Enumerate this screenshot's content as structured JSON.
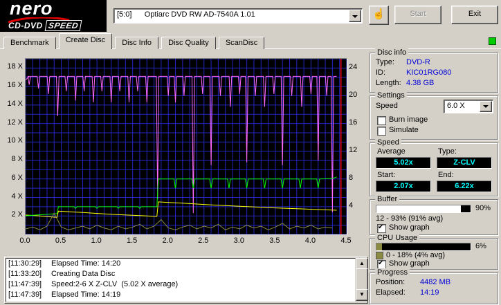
{
  "header": {
    "brand": "nero",
    "brand_sub1": "CD-DVD",
    "brand_sub2": "SPEED",
    "drive_select_value": "[5:0]      Optiarc DVD RW AD-7540A 1.01",
    "start_label": "Start",
    "exit_label": "Exit"
  },
  "tabs": [
    {
      "label": "Benchmark",
      "active": false
    },
    {
      "label": "Create Disc",
      "active": true
    },
    {
      "label": "Disc Info",
      "active": false
    },
    {
      "label": "Disc Quality",
      "active": false
    },
    {
      "label": "ScanDisc",
      "active": false
    }
  ],
  "disc_info": {
    "title": "Disc info",
    "rows": [
      {
        "label": "Type:",
        "value": "DVD-R"
      },
      {
        "label": "ID:",
        "value": "KIC01RG080"
      },
      {
        "label": "Length:",
        "value": "4.38 GB"
      }
    ]
  },
  "settings": {
    "title": "Settings",
    "speed_label": "Speed",
    "speed_value": "6.0 X",
    "checkboxes": [
      {
        "label": "Burn image",
        "checked": false
      },
      {
        "label": "Simulate",
        "checked": false
      }
    ]
  },
  "speed_panel": {
    "title": "Speed",
    "average_label": "Average",
    "type_label": "Type:",
    "average_value": "5.02x",
    "type_value": "Z-CLV",
    "start_label": "Start:",
    "end_label": "End:",
    "start_value": "2.07x",
    "end_value": "6.22x"
  },
  "buffer_panel": {
    "title": "Buffer",
    "fill_percent": 90,
    "bar_color": "#ffffff",
    "percent_label": "90%",
    "range_text": "12 - 93% (91% avg)",
    "show_graph_label": "Show graph",
    "show_graph_checked": true
  },
  "cpu_panel": {
    "title": "CPU Usage",
    "fill_percent": 6,
    "bar_color": "#8a8a42",
    "percent_label": "6%",
    "range_text": "0 - 18% (4% avg)",
    "show_graph_label": "Show graph",
    "show_graph_checked": true,
    "legend_color": "#8a8a42"
  },
  "progress_panel": {
    "title": "Progress",
    "position_label": "Position:",
    "position_value": "4482 MB",
    "elapsed_label": "Elapsed:",
    "elapsed_value": "14:19"
  },
  "log": {
    "lines": [
      {
        "time": "[11:30:29]",
        "text": "Elapsed Time: 14:20"
      },
      {
        "time": "[11:33:20]",
        "text": "Creating Data Disc"
      },
      {
        "time": "[11:47:39]",
        "text": "Speed:2-6 X Z-CLV  (5.02 X average)"
      },
      {
        "time": "[11:47:39]",
        "text": "Elapsed Time: 14:19"
      }
    ]
  },
  "chart_data": {
    "type": "line",
    "title": "Create Disc write test graph",
    "x_axis": {
      "min": 0,
      "max": 4.5,
      "tick_step": 0.5,
      "tick_labels": [
        "0.0",
        "0.5",
        "1.0",
        "1.5",
        "2.0",
        "2.5",
        "3.0",
        "3.5",
        "4.0",
        "4.5"
      ]
    },
    "y_left": {
      "min": 0,
      "max": 19,
      "ticks": [
        {
          "value": 2,
          "label": "2 X"
        },
        {
          "value": 4,
          "label": "4 X"
        },
        {
          "value": 6,
          "label": "6 X"
        },
        {
          "value": 8,
          "label": "8 X"
        },
        {
          "value": 10,
          "label": "10 X"
        },
        {
          "value": 12,
          "label": "12 X"
        },
        {
          "value": 14,
          "label": "14 X"
        },
        {
          "value": 16,
          "label": "16 X"
        },
        {
          "value": 18,
          "label": "18 X"
        }
      ]
    },
    "y_right": {
      "min": 0,
      "max": 25.4,
      "ticks": [
        {
          "value": 4,
          "label": "4"
        },
        {
          "value": 8,
          "label": "8"
        },
        {
          "value": 12,
          "label": "12"
        },
        {
          "value": 16,
          "label": "16"
        },
        {
          "value": 20,
          "label": "20"
        },
        {
          "value": 24,
          "label": "24"
        }
      ]
    },
    "grid": {
      "color": "#2626c0",
      "x_step": 0.1,
      "y_step": 1
    },
    "plot_bg": "#000000",
    "capacity_line": {
      "x": 4.42,
      "color": "#ff0000"
    },
    "series": [
      {
        "name": "buffer_level",
        "color": "#ff6aff",
        "render": "spikes",
        "baseline": 17.1,
        "x_start": 0,
        "x_end": 4.36,
        "spikes": [
          [
            0.05,
            16.2
          ],
          [
            0.18,
            15.8
          ],
          [
            0.32,
            15.2
          ],
          [
            0.45,
            12.8
          ],
          [
            0.57,
            15.5
          ],
          [
            0.7,
            14.5
          ],
          [
            0.82,
            15.5
          ],
          [
            0.95,
            14.3
          ],
          [
            1.07,
            15.5
          ],
          [
            1.2,
            14.3
          ],
          [
            1.32,
            15.5
          ],
          [
            1.45,
            14.3
          ],
          [
            1.57,
            15.5
          ],
          [
            1.7,
            14.3
          ],
          [
            1.85,
            3.8
          ],
          [
            2.0,
            15.0
          ],
          [
            2.1,
            14.3
          ],
          [
            2.22,
            15.0
          ],
          [
            2.35,
            2.3
          ],
          [
            2.48,
            15.2
          ],
          [
            2.6,
            7.5
          ],
          [
            2.73,
            15.0
          ],
          [
            2.87,
            13.8
          ],
          [
            3.0,
            15.2
          ],
          [
            3.1,
            7.8
          ],
          [
            3.22,
            15.0
          ],
          [
            3.35,
            13.8
          ],
          [
            3.48,
            15.2
          ],
          [
            3.6,
            7.5
          ],
          [
            3.73,
            15.0
          ],
          [
            3.87,
            13.8
          ],
          [
            4.0,
            15.2
          ],
          [
            4.1,
            8.0
          ],
          [
            4.22,
            15.0
          ],
          [
            4.3,
            2.4
          ]
        ]
      },
      {
        "name": "rotation_speed",
        "color": "#ffff00",
        "render": "points",
        "points": [
          [
            0,
            2.1
          ],
          [
            0.2,
            2.0
          ],
          [
            0.44,
            1.85
          ],
          [
            0.46,
            2.52
          ],
          [
            0.8,
            2.38
          ],
          [
            1.2,
            2.18
          ],
          [
            1.84,
            1.95
          ],
          [
            1.86,
            3.52
          ],
          [
            2.2,
            3.38
          ],
          [
            2.6,
            3.2
          ],
          [
            3.0,
            3.05
          ],
          [
            3.4,
            2.9
          ],
          [
            3.8,
            2.78
          ],
          [
            4.36,
            2.62
          ]
        ]
      },
      {
        "name": "write_speed",
        "color": "#00ff00",
        "render": "points",
        "points": [
          [
            0,
            2.02
          ],
          [
            0.15,
            2.1
          ],
          [
            0.3,
            2.18
          ],
          [
            0.44,
            2.25
          ],
          [
            0.46,
            3.0
          ],
          [
            0.68,
            3.0
          ],
          [
            0.7,
            2.82
          ],
          [
            0.72,
            3.0
          ],
          [
            0.98,
            3.0
          ],
          [
            1.0,
            2.82
          ],
          [
            1.02,
            3.0
          ],
          [
            1.28,
            3.0
          ],
          [
            1.3,
            2.82
          ],
          [
            1.32,
            3.0
          ],
          [
            1.58,
            3.0
          ],
          [
            1.6,
            2.82
          ],
          [
            1.62,
            3.0
          ],
          [
            1.84,
            3.0
          ],
          [
            1.86,
            6.0
          ],
          [
            2.08,
            6.0
          ],
          [
            2.1,
            5.0
          ],
          [
            2.12,
            6.0
          ],
          [
            2.33,
            6.0
          ],
          [
            2.35,
            5.0
          ],
          [
            2.37,
            6.0
          ],
          [
            2.58,
            6.0
          ],
          [
            2.6,
            5.0
          ],
          [
            2.62,
            6.0
          ],
          [
            2.83,
            6.0
          ],
          [
            2.85,
            5.0
          ],
          [
            2.87,
            6.0
          ],
          [
            3.08,
            6.0
          ],
          [
            3.1,
            5.0
          ],
          [
            3.12,
            6.0
          ],
          [
            3.33,
            6.0
          ],
          [
            3.35,
            5.0
          ],
          [
            3.37,
            6.0
          ],
          [
            3.58,
            6.0
          ],
          [
            3.6,
            5.0
          ],
          [
            3.62,
            6.0
          ],
          [
            3.83,
            6.0
          ],
          [
            3.85,
            5.0
          ],
          [
            3.87,
            6.0
          ],
          [
            4.08,
            6.0
          ],
          [
            4.1,
            5.0
          ],
          [
            4.12,
            6.0
          ],
          [
            4.3,
            6.05
          ],
          [
            4.36,
            6.22
          ]
        ]
      },
      {
        "name": "cpu_usage",
        "color": "#8a8a42",
        "render": "samples",
        "x0": 0,
        "dx": 0.1,
        "values": [
          0.6,
          0.8,
          0.5,
          0.9,
          2.3,
          0.8,
          0.5,
          0.7,
          0.9,
          0.6,
          1.0,
          0.7,
          0.5,
          0.9,
          0.6,
          0.8,
          1.1,
          0.6,
          0.9,
          1.6,
          0.7,
          0.5,
          0.8,
          1.0,
          0.6,
          0.9,
          0.7,
          1.1,
          0.5,
          0.8,
          0.6,
          1.0,
          0.7,
          0.9,
          0.5,
          0.8,
          1.2,
          0.6,
          0.9,
          0.7,
          1.0,
          0.6,
          0.8,
          0.7
        ]
      }
    ]
  }
}
